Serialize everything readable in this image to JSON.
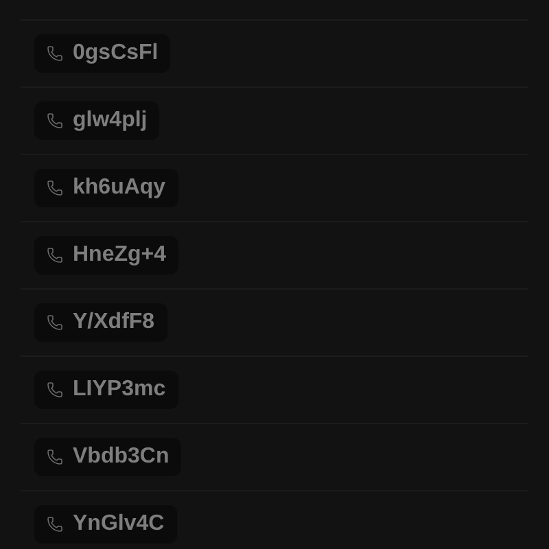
{
  "contacts": [
    {
      "phone": "0gsCsFl"
    },
    {
      "phone": "glw4plj"
    },
    {
      "phone": "kh6uAqy"
    },
    {
      "phone": "HneZg+4"
    },
    {
      "phone": "Y/XdfF8"
    },
    {
      "phone": "LIYP3mc"
    },
    {
      "phone": "Vbdb3Cn"
    },
    {
      "phone": "YnGlv4C"
    }
  ]
}
